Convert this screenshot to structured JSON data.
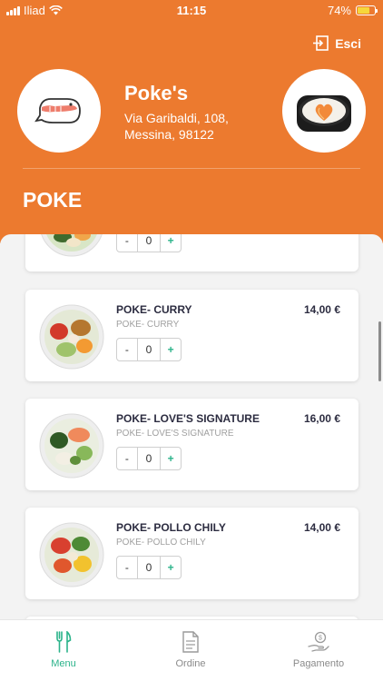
{
  "status_bar": {
    "carrier": "Iliad",
    "time": "11:15",
    "battery": "74%",
    "battery_level": 0.74
  },
  "header": {
    "logout_label": "Esci",
    "store_name": "Poke's",
    "address_line1": "Via Garibaldi, 108,",
    "address_line2": "Messina, 98122",
    "category": "POKE"
  },
  "items": [
    {
      "name": "",
      "description": "",
      "price": "",
      "qty": "0"
    },
    {
      "name": "POKE- CURRY",
      "description": "POKE- CURRY",
      "price": "14,00 €",
      "qty": "0"
    },
    {
      "name": "POKE- LOVE'S SIGNATURE",
      "description": "POKE- LOVE'S SIGNATURE",
      "price": "16,00 €",
      "qty": "0"
    },
    {
      "name": "POKE- POLLO CHILY",
      "description": "POKE- POLLO CHILY",
      "price": "14,00 €",
      "qty": "0"
    }
  ],
  "stepper": {
    "minus": "-",
    "plus": "+"
  },
  "tabs": [
    {
      "label": "Menu",
      "icon": "cutlery-icon",
      "active": true
    },
    {
      "label": "Ordine",
      "icon": "document-icon",
      "active": false
    },
    {
      "label": "Pagamento",
      "icon": "hand-coin-icon",
      "active": false
    }
  ],
  "colors": {
    "brand": "#ec7a2f",
    "accent": "#2bb38a",
    "text": "#2c2c40"
  }
}
